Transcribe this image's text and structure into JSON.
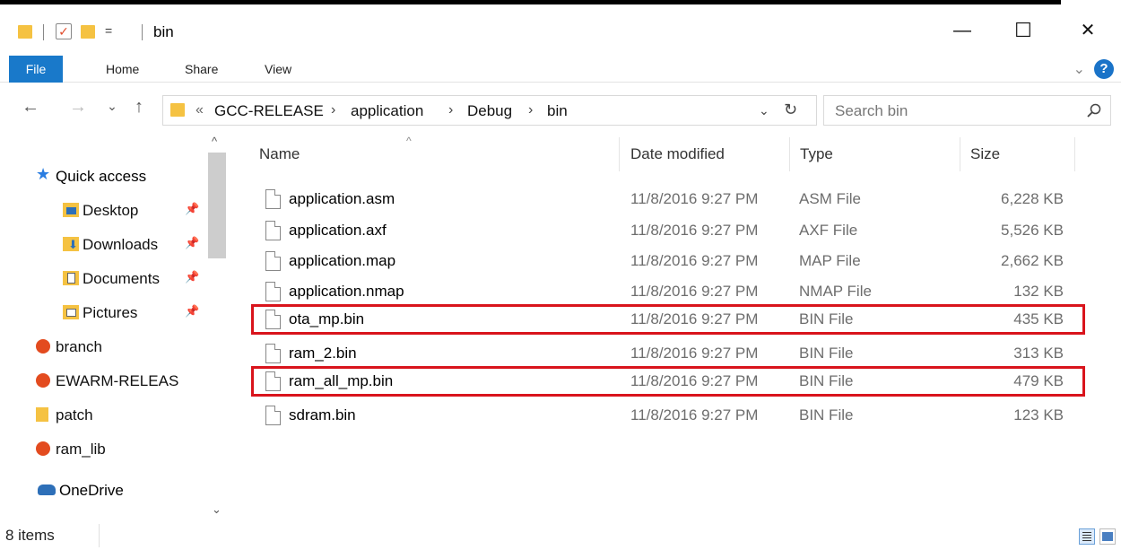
{
  "window": {
    "title": "bin",
    "quick_toolbar_dropdown": "=",
    "minimize": "—",
    "maximize": "☐",
    "close": "✕"
  },
  "ribbon": {
    "tabs": [
      "File",
      "Home",
      "Share",
      "View"
    ],
    "help": "?"
  },
  "address": {
    "overflow": "«",
    "crumbs": [
      "GCC-RELEASE",
      "application",
      "Debug",
      "bin"
    ],
    "refresh": "↻"
  },
  "search": {
    "placeholder": "Search bin"
  },
  "navpane": {
    "quick_access": "Quick access",
    "items": [
      {
        "label": "Desktop",
        "icon": "desktop-folder-icon",
        "pinned": true
      },
      {
        "label": "Downloads",
        "icon": "downloads-folder-icon",
        "pinned": true
      },
      {
        "label": "Documents",
        "icon": "documents-folder-icon",
        "pinned": true
      },
      {
        "label": "Pictures",
        "icon": "pictures-folder-icon",
        "pinned": true
      },
      {
        "label": "branch",
        "icon": "app-folder-icon",
        "pinned": false
      },
      {
        "label": "EWARM-RELEAS",
        "icon": "app-folder-icon",
        "pinned": false
      },
      {
        "label": "patch",
        "icon": "folder-icon",
        "pinned": false
      },
      {
        "label": "ram_lib",
        "icon": "app-folder-icon",
        "pinned": false
      }
    ],
    "onedrive": "OneDrive"
  },
  "columns": {
    "name": "Name",
    "date": "Date modified",
    "type": "Type",
    "size": "Size"
  },
  "files": [
    {
      "name": "application.asm",
      "date": "11/8/2016 9:27 PM",
      "type": "ASM File",
      "size": "6,228 KB",
      "highlighted": false
    },
    {
      "name": "application.axf",
      "date": "11/8/2016 9:27 PM",
      "type": "AXF File",
      "size": "5,526 KB",
      "highlighted": false
    },
    {
      "name": "application.map",
      "date": "11/8/2016 9:27 PM",
      "type": "MAP File",
      "size": "2,662 KB",
      "highlighted": false
    },
    {
      "name": "application.nmap",
      "date": "11/8/2016 9:27 PM",
      "type": "NMAP File",
      "size": "132 KB",
      "highlighted": false
    },
    {
      "name": "ota_mp.bin",
      "date": "11/8/2016 9:27 PM",
      "type": "BIN File",
      "size": "435 KB",
      "highlighted": true
    },
    {
      "name": "ram_2.bin",
      "date": "11/8/2016 9:27 PM",
      "type": "BIN File",
      "size": "313 KB",
      "highlighted": false
    },
    {
      "name": "ram_all_mp.bin",
      "date": "11/8/2016 9:27 PM",
      "type": "BIN File",
      "size": "479 KB",
      "highlighted": true
    },
    {
      "name": "sdram.bin",
      "date": "11/8/2016 9:27 PM",
      "type": "BIN File",
      "size": "123 KB",
      "highlighted": false
    }
  ],
  "status": {
    "item_count": "8 items"
  },
  "colors": {
    "file_tab": "#1979ca",
    "highlight": "#d9141c",
    "folder": "#f5c242"
  }
}
